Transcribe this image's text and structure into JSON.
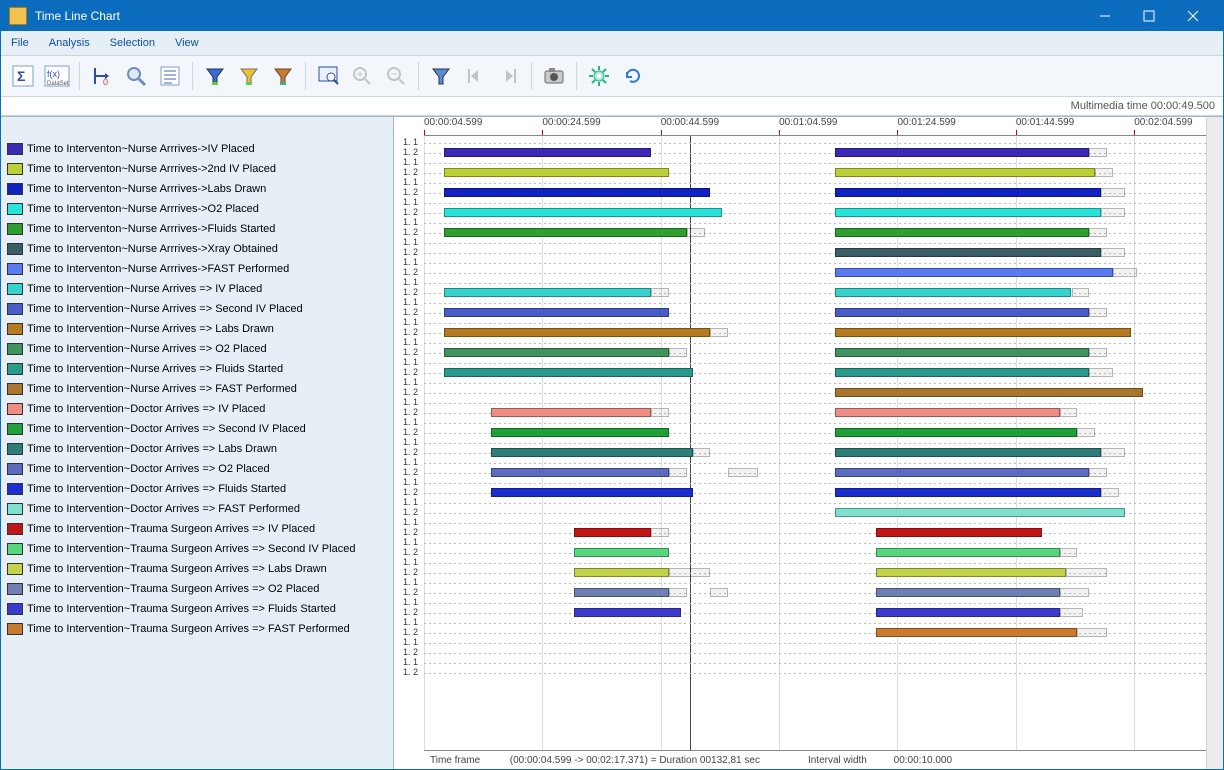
{
  "window": {
    "title": "Time Line Chart"
  },
  "menu": [
    "File",
    "Analysis",
    "Selection",
    "View"
  ],
  "toolbar": [
    {
      "name": "sigma",
      "dis": false
    },
    {
      "name": "fx-dataset",
      "dis": false
    },
    {
      "sep": true
    },
    {
      "name": "anchor-zero",
      "dis": false
    },
    {
      "name": "magnifier",
      "dis": false
    },
    {
      "name": "list",
      "dis": false
    },
    {
      "sep": true
    },
    {
      "name": "funnel-blue",
      "dis": false
    },
    {
      "name": "funnel-yellow",
      "dis": false
    },
    {
      "name": "funnel-mix",
      "dis": false
    },
    {
      "sep": true
    },
    {
      "name": "zoom-frame",
      "dis": false
    },
    {
      "name": "zoom-in",
      "dis": true
    },
    {
      "name": "zoom-out",
      "dis": true
    },
    {
      "sep": true
    },
    {
      "name": "filter",
      "dis": false
    },
    {
      "name": "step-left",
      "dis": true
    },
    {
      "name": "step-right",
      "dis": true
    },
    {
      "sep": true
    },
    {
      "name": "camera",
      "dis": false
    },
    {
      "sep": true
    },
    {
      "name": "gear",
      "dis": false
    },
    {
      "name": "refresh",
      "dis": false
    }
  ],
  "info": {
    "multimedia_time_label": "Multimedia time",
    "multimedia_time": "00:00:49.500"
  },
  "timeline": {
    "start": 4.599,
    "end": 137.4,
    "ticks": [
      {
        "t": 4.599,
        "label": "00:00:04.599"
      },
      {
        "t": 24.599,
        "label": "00:00:24.599"
      },
      {
        "t": 44.599,
        "label": "00:00:44.599"
      },
      {
        "t": 64.599,
        "label": "00:01:04.599"
      },
      {
        "t": 84.599,
        "label": "00:01:24.599"
      },
      {
        "t": 104.599,
        "label": "00:01:44.599"
      },
      {
        "t": 124.599,
        "label": "00:02:04.599"
      }
    ],
    "cursor": 49.5,
    "rowlabel_pattern": [
      "1. 1",
      "1. 2"
    ],
    "empty_tail_rows": 2
  },
  "status": {
    "frame_label": "Time frame",
    "frame_value": "(00:00:04.599 -> 00:02:17.371) = Duration 00132,81 sec",
    "interval_label": "Interval width",
    "interval_value": "00:00:10.000"
  },
  "chart_data": {
    "type": "bar",
    "rows": [
      {
        "label": "Time to Interventon~Nurse Arrrives->IV Placed",
        "color": "#3a2ab6",
        "bars": [
          {
            "s": 8,
            "e": 43
          },
          {
            "s": 74,
            "e": 117
          }
        ],
        "partials": [
          {
            "s": 117,
            "e": 120
          }
        ]
      },
      {
        "label": "Time to Interventon~Nurse Arrrives->2nd IV Placed",
        "color": "#bccf37",
        "bars": [
          {
            "s": 8,
            "e": 46
          },
          {
            "s": 74,
            "e": 118
          }
        ],
        "partials": [
          {
            "s": 118,
            "e": 121
          }
        ]
      },
      {
        "label": "Time to Interventon~Nurse Arrrives->Labs Drawn",
        "color": "#1022c1",
        "bars": [
          {
            "s": 8,
            "e": 53
          },
          {
            "s": 74,
            "e": 119
          }
        ],
        "partials": [
          {
            "s": 119,
            "e": 123
          }
        ]
      },
      {
        "label": "Time to Interventon~Nurse Arrrives->O2 Placed",
        "color": "#27e3d9",
        "bars": [
          {
            "s": 8,
            "e": 55
          },
          {
            "s": 74,
            "e": 119
          }
        ],
        "partials": [
          {
            "s": 119,
            "e": 123
          }
        ]
      },
      {
        "label": "Time to Interventon~Nurse Arrrives->Fluids Started",
        "color": "#2e9e2e",
        "bars": [
          {
            "s": 8,
            "e": 49
          },
          {
            "s": 74,
            "e": 117
          }
        ],
        "partials": [
          {
            "s": 49,
            "e": 52
          },
          {
            "s": 117,
            "e": 120
          }
        ]
      },
      {
        "label": "Time to Interventon~Nurse Arrrives->Xray Obtained",
        "color": "#3b5d65",
        "bars": [
          {
            "s": 74,
            "e": 119
          }
        ],
        "partials": [
          {
            "s": 119,
            "e": 123
          }
        ]
      },
      {
        "label": "Time to Interventon~Nurse Arrrives->FAST Performed",
        "color": "#5a7af2",
        "bars": [
          {
            "s": 74,
            "e": 121
          }
        ],
        "partials": [
          {
            "s": 121,
            "e": 125
          }
        ]
      },
      {
        "label": "Time to Intervention~Nurse Arrives => IV Placed",
        "color": "#36d2cb",
        "bars": [
          {
            "s": 8,
            "e": 43
          },
          {
            "s": 74,
            "e": 114
          }
        ],
        "partials": [
          {
            "s": 43,
            "e": 46
          },
          {
            "s": 114,
            "e": 117
          }
        ]
      },
      {
        "label": "Time to Intervention~Nurse Arrives => Second IV Placed",
        "color": "#4a5cc9",
        "bars": [
          {
            "s": 8,
            "e": 46
          },
          {
            "s": 74,
            "e": 117
          }
        ],
        "partials": [
          {
            "s": 117,
            "e": 120
          }
        ]
      },
      {
        "label": "Time to Intervention~Nurse Arrives => Labs Drawn",
        "color": "#b67a22",
        "bars": [
          {
            "s": 8,
            "e": 53
          },
          {
            "s": 74,
            "e": 124
          }
        ],
        "partials": [
          {
            "s": 53,
            "e": 56
          }
        ]
      },
      {
        "label": "Time to Intervention~Nurse Arrives => O2 Placed",
        "color": "#3f935c",
        "bars": [
          {
            "s": 8,
            "e": 46
          },
          {
            "s": 74,
            "e": 117
          }
        ],
        "partials": [
          {
            "s": 46,
            "e": 49
          },
          {
            "s": 117,
            "e": 120
          }
        ]
      },
      {
        "label": "Time to Intervention~Nurse Arrives => Fluids Started",
        "color": "#2a9a8a",
        "bars": [
          {
            "s": 8,
            "e": 50
          },
          {
            "s": 74,
            "e": 117
          }
        ],
        "partials": [
          {
            "s": 117,
            "e": 121
          }
        ]
      },
      {
        "label": "Time to Intervention~Nurse Arrives => FAST Performed",
        "color": "#a8762f",
        "bars": [
          {
            "s": 74,
            "e": 126
          }
        ]
      },
      {
        "label": "Time to Intervention~Doctor Arrives => IV Placed",
        "color": "#ee8d83",
        "bars": [
          {
            "s": 16,
            "e": 43
          },
          {
            "s": 74,
            "e": 112
          }
        ],
        "partials": [
          {
            "s": 43,
            "e": 46
          },
          {
            "s": 112,
            "e": 115
          }
        ]
      },
      {
        "label": "Time to Intervention~Doctor Arrives => Second IV Placed",
        "color": "#1fa03a",
        "bars": [
          {
            "s": 16,
            "e": 46
          },
          {
            "s": 74,
            "e": 115
          }
        ],
        "partials": [
          {
            "s": 115,
            "e": 118
          }
        ]
      },
      {
        "label": "Time to Intervention~Doctor Arrives => Labs Drawn",
        "color": "#2e7d78",
        "bars": [
          {
            "s": 16,
            "e": 50
          },
          {
            "s": 74,
            "e": 119
          }
        ],
        "partials": [
          {
            "s": 50,
            "e": 53
          },
          {
            "s": 119,
            "e": 123
          }
        ]
      },
      {
        "label": "Time to Intervention~Doctor Arrives => O2 Placed",
        "color": "#5b6bbf",
        "bars": [
          {
            "s": 16,
            "e": 46
          },
          {
            "s": 74,
            "e": 117
          }
        ],
        "partials": [
          {
            "s": 46,
            "e": 49
          },
          {
            "s": 56,
            "e": 61
          },
          {
            "s": 117,
            "e": 120
          }
        ]
      },
      {
        "label": "Time to Intervention~Doctor Arrives => Fluids Started",
        "color": "#1b2fcf",
        "bars": [
          {
            "s": 16,
            "e": 50
          },
          {
            "s": 74,
            "e": 119
          }
        ],
        "partials": [
          {
            "s": 119,
            "e": 122
          }
        ]
      },
      {
        "label": "Time to Intervention~Doctor Arrives => FAST Performed",
        "color": "#7ee0cf",
        "bars": [
          {
            "s": 74,
            "e": 123
          }
        ],
        "partials": []
      },
      {
        "label": "Time to Intervention~Trauma Surgeon Arrives => IV Placed",
        "color": "#c11717",
        "bars": [
          {
            "s": 30,
            "e": 43
          },
          {
            "s": 81,
            "e": 109
          }
        ],
        "partials": [
          {
            "s": 43,
            "e": 46
          }
        ]
      },
      {
        "label": "Time to Intervention~Trauma Surgeon Arrives => Second IV Placed",
        "color": "#56d77e",
        "bars": [
          {
            "s": 30,
            "e": 46
          },
          {
            "s": 81,
            "e": 112
          }
        ],
        "partials": [
          {
            "s": 112,
            "e": 115
          }
        ]
      },
      {
        "label": "Time to Intervention~Trauma Surgeon Arrives => Labs Drawn",
        "color": "#c4d24a",
        "bars": [
          {
            "s": 30,
            "e": 46
          },
          {
            "s": 81,
            "e": 113
          }
        ],
        "partials": [
          {
            "s": 46,
            "e": 53
          },
          {
            "s": 113,
            "e": 120
          }
        ]
      },
      {
        "label": "Time to Intervention~Trauma Surgeon Arrives => O2 Placed",
        "color": "#6f7fb4",
        "bars": [
          {
            "s": 30,
            "e": 46
          },
          {
            "s": 81,
            "e": 112
          }
        ],
        "partials": [
          {
            "s": 46,
            "e": 49
          },
          {
            "s": 53,
            "e": 56
          },
          {
            "s": 112,
            "e": 117
          }
        ]
      },
      {
        "label": "Time to Intervention~Trauma Surgeon Arrives => Fluids Started",
        "color": "#3b3bcb",
        "bars": [
          {
            "s": 30,
            "e": 48
          },
          {
            "s": 81,
            "e": 112
          }
        ],
        "partials": [
          {
            "s": 112,
            "e": 116
          }
        ]
      },
      {
        "label": "Time to Intervention~Trauma Surgeon Arrives => FAST Performed",
        "color": "#c97a2f",
        "bars": [
          {
            "s": 81,
            "e": 115
          }
        ],
        "partials": [
          {
            "s": 115,
            "e": 120
          }
        ]
      }
    ]
  }
}
